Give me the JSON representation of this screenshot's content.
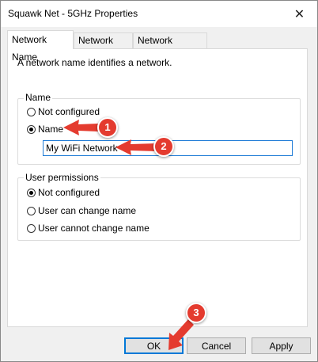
{
  "window": {
    "title": "Squawk Net - 5GHz Properties",
    "close_glyph": "✕"
  },
  "tabs": [
    {
      "label": "Network Name",
      "active": true
    },
    {
      "label": "Network Icon",
      "active": false
    },
    {
      "label": "Network Location",
      "active": false
    }
  ],
  "description": "A network name identifies a network.",
  "name_group": {
    "legend": "Name",
    "options": [
      {
        "label": "Not configured",
        "checked": false
      },
      {
        "label": "Name",
        "checked": true
      }
    ],
    "input_value": "My WiFi Network"
  },
  "permissions_group": {
    "legend": "User permissions",
    "options": [
      {
        "label": "Not configured",
        "checked": true
      },
      {
        "label": "User can change name",
        "checked": false
      },
      {
        "label": "User cannot change name",
        "checked": false
      }
    ]
  },
  "buttons": {
    "ok": "OK",
    "cancel": "Cancel",
    "apply": "Apply"
  },
  "annotations": {
    "one": "1",
    "two": "2",
    "three": "3"
  },
  "colors": {
    "annotation": "#e43b2f",
    "focus_border": "#1e7bd6"
  }
}
